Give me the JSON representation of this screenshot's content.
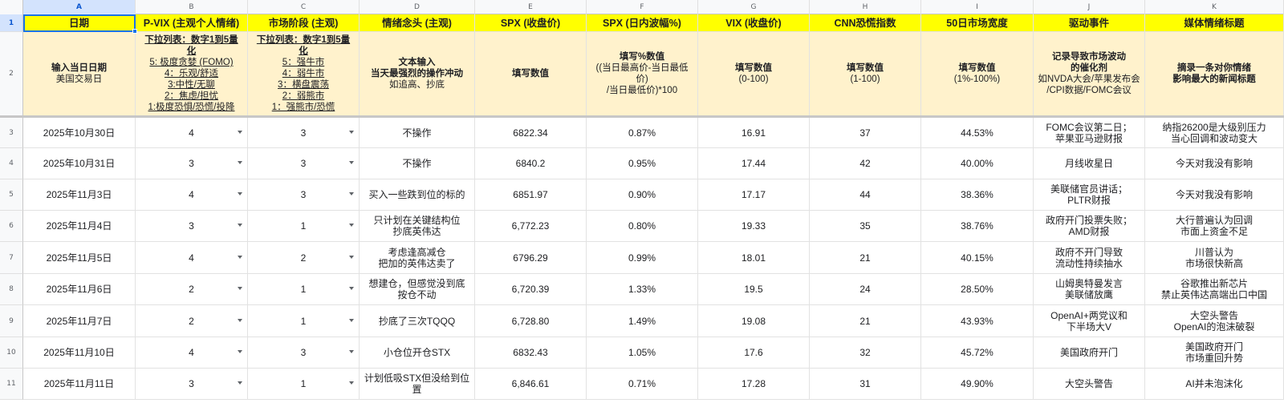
{
  "columns": [
    {
      "letter": "A",
      "header": "日期",
      "desc": [
        {
          "t": "输入当日日期",
          "c": "b"
        },
        {
          "t": "美国交易日",
          "c": "n"
        }
      ]
    },
    {
      "letter": "B",
      "header": "P-VIX (主观个人情绪)",
      "desc": [
        {
          "t": "下拉列表：数字1到5量",
          "c": "b u"
        },
        {
          "t": "化",
          "c": "b u"
        },
        {
          "t": "5: 极度贪婪 (FOMO)",
          "c": "u"
        },
        {
          "t": "4：乐观/舒适",
          "c": "u"
        },
        {
          "t": "3:中性/无聊",
          "c": "u"
        },
        {
          "t": "2：焦虑/担忧",
          "c": "u"
        },
        {
          "t": "1:极度恐惧/恐慌/投降",
          "c": "u"
        }
      ]
    },
    {
      "letter": "C",
      "header": "市场阶段 (主观)",
      "desc": [
        {
          "t": "下拉列表：数字1到5量",
          "c": "b u"
        },
        {
          "t": "化",
          "c": "b u"
        },
        {
          "t": "5：强牛市",
          "c": "u"
        },
        {
          "t": "4：弱牛市",
          "c": "u"
        },
        {
          "t": "3：横盘震荡",
          "c": "u"
        },
        {
          "t": "2：弱熊市",
          "c": "u"
        },
        {
          "t": "1：强熊市/恐慌",
          "c": "u"
        }
      ]
    },
    {
      "letter": "D",
      "header": "情绪念头 (主观)",
      "desc": [
        {
          "t": "文本输入",
          "c": "b"
        },
        {
          "t": "当天最强烈的操作冲动",
          "c": "b"
        },
        {
          "t": "如追高、抄底",
          "c": "n"
        }
      ]
    },
    {
      "letter": "E",
      "header": "SPX (收盘价)",
      "desc": [
        {
          "t": "填写数值",
          "c": "b"
        }
      ]
    },
    {
      "letter": "F",
      "header": "SPX (日内波幅%)",
      "desc": [
        {
          "t": "填写%数值",
          "c": "b"
        },
        {
          "t": "((当日最高价-当日最低",
          "c": "n"
        },
        {
          "t": "价)",
          "c": "n"
        },
        {
          "t": "/当日最低价)*100",
          "c": "n"
        }
      ]
    },
    {
      "letter": "G",
      "header": "VIX (收盘价)",
      "desc": [
        {
          "t": "填写数值",
          "c": "b"
        },
        {
          "t": "(0-100)",
          "c": "n"
        }
      ]
    },
    {
      "letter": "H",
      "header": "CNN恐慌指数",
      "desc": [
        {
          "t": "填写数值",
          "c": "b"
        },
        {
          "t": "(1-100)",
          "c": "n"
        }
      ]
    },
    {
      "letter": "I",
      "header": "50日市场宽度",
      "desc": [
        {
          "t": "填写数值",
          "c": "b"
        },
        {
          "t": "(1%-100%)",
          "c": "n"
        }
      ]
    },
    {
      "letter": "J",
      "header": "驱动事件",
      "desc": [
        {
          "t": "记录导致市场波动",
          "c": "b"
        },
        {
          "t": "的催化剂",
          "c": "b"
        },
        {
          "t": "如NVDA大会/苹果发布会",
          "c": "n"
        },
        {
          "t": "/CPI数据/FOMC会议",
          "c": "n"
        }
      ]
    },
    {
      "letter": "K",
      "header": "媒体情绪标题",
      "desc": [
        {
          "t": "摘录一条对你情绪",
          "c": "b"
        },
        {
          "t": "影响最大的新闻标题",
          "c": "b"
        }
      ]
    }
  ],
  "rows": [
    {
      "num": "3",
      "cells": [
        "2025年10月30日",
        "4",
        "3",
        "不操作",
        "6822.34",
        "0.87%",
        "16.91",
        "37",
        "44.53%",
        "FOMC会议第二日；\n苹果亚马逊财报",
        "纳指26200是大级别压力\n当心回调和波动变大"
      ]
    },
    {
      "num": "4",
      "cells": [
        "2025年10月31日",
        "3",
        "3",
        "不操作",
        "6840.2",
        "0.95%",
        "17.44",
        "42",
        "40.00%",
        "月线收星日",
        "今天对我没有影响"
      ]
    },
    {
      "num": "5",
      "cells": [
        "2025年11月3日",
        "4",
        "3",
        "买入一些跌到位的标的",
        "6851.97",
        "0.90%",
        "17.17",
        "44",
        "38.36%",
        "美联储官员讲话；\nPLTR财报",
        "今天对我没有影响"
      ]
    },
    {
      "num": "6",
      "cells": [
        "2025年11月4日",
        "3",
        "1",
        "只计划在关键结构位\n抄底英伟达",
        "6,772.23",
        "0.80%",
        "19.33",
        "35",
        "38.76%",
        "政府开门投票失败；\nAMD财报",
        "大行普遍认为回调\n市面上资金不足"
      ]
    },
    {
      "num": "7",
      "cells": [
        "2025年11月5日",
        "4",
        "2",
        "考虑逢高减仓\n把加的英伟达卖了",
        "6796.29",
        "0.99%",
        "18.01",
        "21",
        "40.15%",
        "政府不开门导致\n流动性持续抽水",
        "川普认为\n市场很快新高"
      ]
    },
    {
      "num": "8",
      "cells": [
        "2025年11月6日",
        "2",
        "1",
        "想建仓，但感觉没到底\n按仓不动",
        "6,720.39",
        "1.33%",
        "19.5",
        "24",
        "28.50%",
        "山姆奥特曼发言\n美联储放鹰",
        "谷歌推出新芯片\n禁止英伟达高端出口中国"
      ]
    },
    {
      "num": "9",
      "cells": [
        "2025年11月7日",
        "2",
        "1",
        "抄底了三次TQQQ",
        "6,728.80",
        "1.49%",
        "19.08",
        "21",
        "43.93%",
        "OpenAI+两党议和\n下半场大V",
        "大空头警告\nOpenAI的泡沫破裂"
      ]
    },
    {
      "num": "10",
      "cells": [
        "2025年11月10日",
        "4",
        "3",
        "小仓位开仓STX",
        "6832.43",
        "1.05%",
        "17.6",
        "32",
        "45.72%",
        "美国政府开门",
        "美国政府开门\n市场重回升势"
      ]
    },
    {
      "num": "11",
      "cells": [
        "2025年11月11日",
        "3",
        "1",
        "计划低吸STX但没给到位置",
        "6,846.61",
        "0.71%",
        "17.28",
        "31",
        "49.90%",
        "大空头警告",
        "AI并未泡沫化"
      ]
    }
  ],
  "header_row_num": "1",
  "desc_row_num": "2",
  "accent": "#1a73e8",
  "header_bg": "#ffff00",
  "desc_bg": "#fff2cc"
}
